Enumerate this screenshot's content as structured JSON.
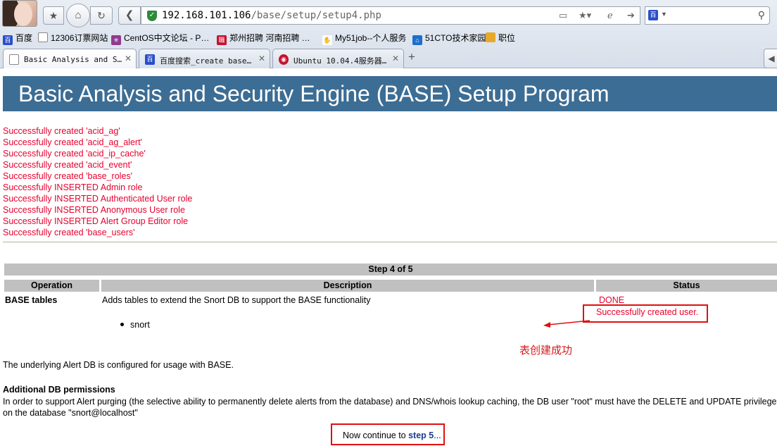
{
  "browser": {
    "url_host": "192.168.101.106",
    "url_path": "/base/setup/setup4.php",
    "bookmarks": [
      {
        "label": "百度",
        "icon": "baidu-paw-icon",
        "color": "#2b4fc9"
      },
      {
        "label": "12306订票网站",
        "icon": "page-icon",
        "color": "#ffffff"
      },
      {
        "label": "CentOS中文论坛 - P…",
        "icon": "centos-icon",
        "color": "#8f3b8f"
      },
      {
        "label": "郑州招聘 河南招聘 …",
        "icon": "job-site-icon",
        "color": "#c8102e"
      },
      {
        "label": "My51job--个人服务",
        "icon": "hand-icon",
        "color": "#333333"
      },
      {
        "label": "51CTO技术家园",
        "icon": "home-icon",
        "color": "#1e6fc9"
      },
      {
        "label": "职位",
        "icon": "folder-icon",
        "color": "#e8a82a"
      }
    ],
    "tabs": [
      {
        "title": "Basic Analysis and S…",
        "icon": "page-icon",
        "active": true
      },
      {
        "title": "百度搜索_create base…",
        "icon": "baidu-paw-icon",
        "active": false
      },
      {
        "title": "Ubuntu 10.04.4服务器…",
        "icon": "ubuntu-icon",
        "active": false
      }
    ]
  },
  "page": {
    "banner_title": "Basic Analysis and Security Engine (BASE) Setup Program",
    "messages": [
      "Successfully created 'acid_ag'",
      "Successfully created 'acid_ag_alert'",
      "Successfully created 'acid_ip_cache'",
      "Successfully created 'acid_event'",
      "Successfully created 'base_roles'",
      "Successfully INSERTED Admin role",
      "Successfully INSERTED Authenticated User role",
      "Successfully INSERTED Anonymous User role",
      "Successfully INSERTED Alert Group Editor role",
      "Successfully created 'base_users'"
    ],
    "step_label": "Step 4 of 5",
    "table": {
      "headers": {
        "operation": "Operation",
        "description": "Description",
        "status": "Status"
      },
      "row": {
        "operation": "BASE tables",
        "description": "Adds tables to extend the Snort DB to support the BASE functionality",
        "databases": [
          "snort"
        ],
        "status_done": "DONE",
        "status_user": "Successfully created user."
      }
    },
    "annotation": "表创建成功",
    "configured_text": "The underlying Alert DB is configured for usage with BASE.",
    "permissions_heading": "Additional DB permissions",
    "permissions_text": "In order to support Alert purging (the selective ability to permanently delete alerts from the database) and DNS/whois lookup caching, the DB user \"root\" must have the DELETE and UPDATE privilege on the database \"snort@localhost\"",
    "continue_prefix": "Now continue to ",
    "continue_link": "step 5",
    "continue_suffix": "..."
  },
  "colors": {
    "banner": "#3c6d94",
    "success_text": "#e8002d",
    "header_gray": "#c0c0c0",
    "annotation_red": "#e01010"
  }
}
